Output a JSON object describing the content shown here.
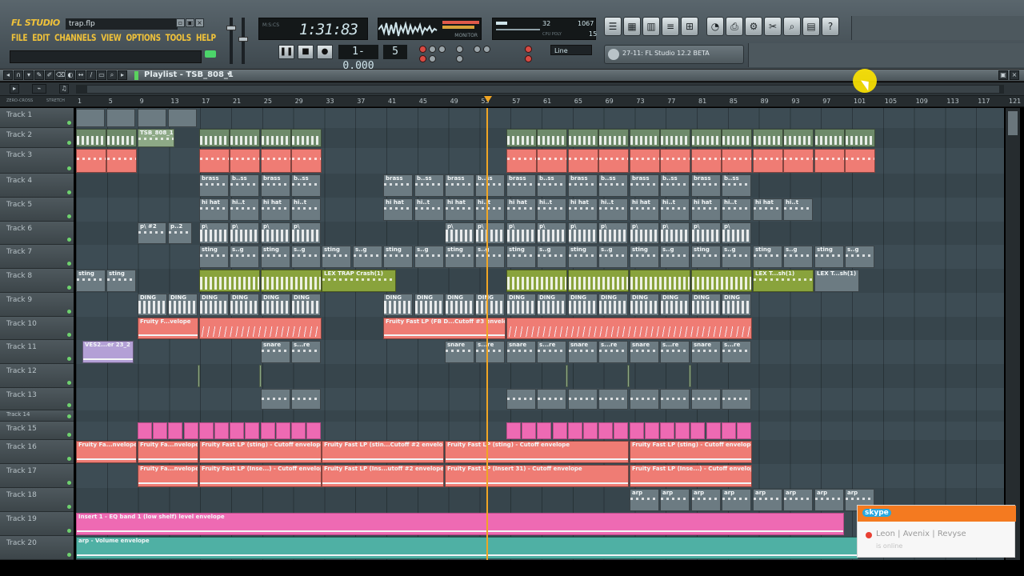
{
  "app": {
    "logo": "FL STUDIO",
    "filename": "trap.flp",
    "menu": [
      "FILE",
      "EDIT",
      "CHANNELS",
      "VIEW",
      "OPTIONS",
      "TOOLS",
      "HELP"
    ]
  },
  "transport": {
    "time": "1:31:83",
    "pattern": "1-0.000",
    "tempo": "5",
    "snap": "Line",
    "monitor": "MONITOR",
    "cpu": "32",
    "memory": "1067",
    "poly": "15"
  },
  "hint": "27-11: FL Studio 12.2 BETA",
  "playlist": {
    "title": "Playlist - TSB_808_1",
    "zero_cross": "ZERO-CROSS",
    "stretch": "STRETCH",
    "bars": [
      "1",
      "5",
      "9",
      "13",
      "17",
      "21",
      "25",
      "29",
      "33",
      "37",
      "41",
      "45",
      "49",
      "53",
      "57",
      "61",
      "65",
      "69",
      "73",
      "77",
      "81",
      "85",
      "89",
      "93",
      "97",
      "101",
      "105",
      "109",
      "113",
      "117",
      "121"
    ],
    "tracks": [
      "Track 1",
      "Track 2",
      "Track 3",
      "Track 4",
      "Track 5",
      "Track 6",
      "Track 7",
      "Track 8",
      "Track 9",
      "Track 10",
      "Track 11",
      "Track 12",
      "Track 13",
      "Track 14",
      "Track 15",
      "Track 16",
      "Track 17",
      "Track 18",
      "Track 19",
      "Track 20"
    ]
  },
  "clips": {
    "tsb": "TSB_808_1",
    "brass": "brass",
    "brass_short": "b..ss",
    "hihat": "hi hat",
    "hihat_short": "hi..t",
    "up": "p\\",
    "up2": "p\\ #2",
    "up2b": "p..2",
    "sting": "sting",
    "sting_short": "s..g",
    "crash1": "LEX TRAP Crash(1)",
    "crash2": "LEX T...sh(1)",
    "ding": "DING",
    "ding_short": "D...G",
    "env10a": "Fruity F...velope",
    "env10b": "Fruity Fast LP (FB D...Cutoff #3 envelope",
    "ves": "VES2...er 23_2",
    "snare": "snare",
    "snare_short": "s...re",
    "env16a": "Fruity Fa...nvelope",
    "env16b": "Fruity Fa...nvelope",
    "env16c": "Fruity Fast LP (sting) - Cutoff envelope",
    "env16d": "Fruity Fast LP (stin...Cutoff #2 envelope",
    "env16e": "Fruity Fast LP (sting) - Cutoff envelope",
    "env16f": "Fruity Fast LP (sting) - Cutoff envelope",
    "env17a": "Fruity Fa...nvelope",
    "env17b": "Fruity Fast LP (Inse...) - Cutoff envelope",
    "env17c": "Fruity Fast LP (Ins...utoff #2 envelope",
    "env17d": "Fruity Fast LP (Insert 31) - Cutoff envelope",
    "env17e": "Fruity Fast LP (Inse...) - Cutoff envelope",
    "arp": "arp",
    "env19": "Insert 1 - EQ band 1 (low shelf) level envelope",
    "env20": "arp - Volume envelope"
  },
  "toast": {
    "app": "skype",
    "name": "Leon | Avenix | Revyse",
    "status": "is online"
  },
  "colors": {
    "accent": "#f0c23a",
    "playhead": "#f0a524"
  }
}
